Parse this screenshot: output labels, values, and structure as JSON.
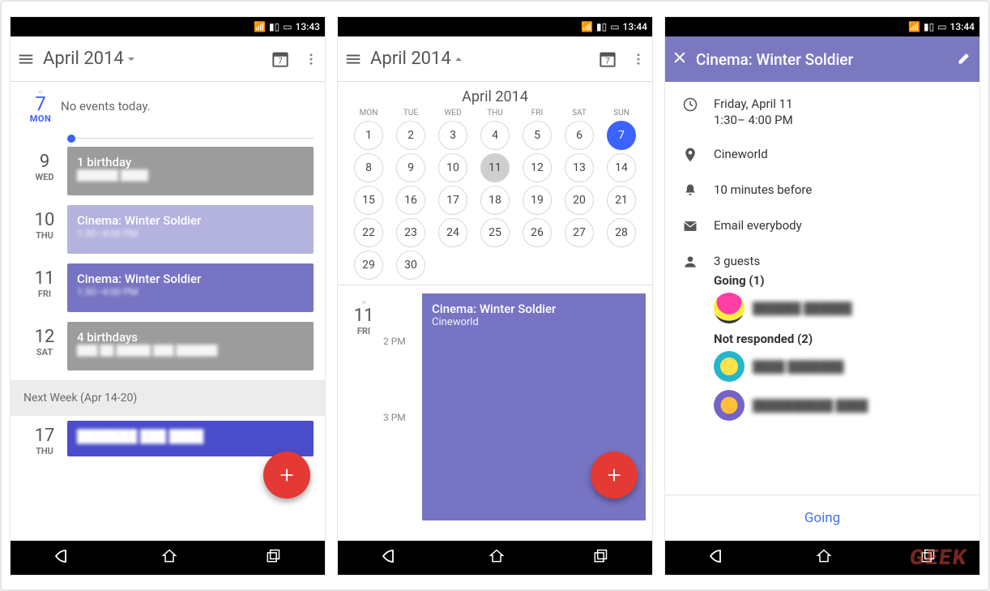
{
  "status": {
    "time1": "13:43",
    "time2": "13:44",
    "time3": "13:44"
  },
  "appbar": {
    "title": "April 2014",
    "cal_num": "7"
  },
  "agenda": {
    "today": {
      "num": "7",
      "dow": "MON"
    },
    "no_events": "No events today.",
    "rows": [
      {
        "num": "9",
        "dow": "WED",
        "kind": "gray",
        "t1": "1 birthday",
        "t2": "██████ ████"
      },
      {
        "num": "10",
        "dow": "THU",
        "kind": "lightpurple",
        "t1": "Cinema: Winter Soldier",
        "t2": "1:30–4:00 PM"
      },
      {
        "num": "11",
        "dow": "FRI",
        "kind": "purple",
        "t1": "Cinema: Winter Soldier",
        "t2": "1:30–4:00 PM"
      },
      {
        "num": "12",
        "dow": "SAT",
        "kind": "gray",
        "t1": "4 birthdays",
        "t2": "███ ██ █████ ███ ██████"
      }
    ],
    "next_week": "Next Week (Apr 14-20)",
    "partial": {
      "num": "17",
      "dow": "THU",
      "t1": "███████ ███ ████"
    }
  },
  "month": {
    "header": "April 2014",
    "weekdays": [
      "MON",
      "TUE",
      "WED",
      "THU",
      "FRI",
      "SAT",
      "SUN"
    ],
    "first_offset": 0,
    "days_in_month": 30,
    "today": 7,
    "selected": 11,
    "sel_date": {
      "num": "11",
      "dow": "FRI"
    },
    "hours": [
      "2 PM",
      "3 PM"
    ],
    "event": {
      "t1": "Cinema: Winter Soldier",
      "t2": "Cineworld"
    }
  },
  "detail": {
    "title": "Cinema: Winter Soldier",
    "date": "Friday, April 11",
    "time": "1:30– 4:00 PM",
    "location": "Cineworld",
    "reminder": "10 minutes before",
    "email": "Email everybody",
    "guests_count": "3 guests",
    "going_label": "Going (1)",
    "notresp_label": "Not responded (2)",
    "guest1": "██████ ██████",
    "guest2": "████ ███████",
    "guest3": "██████████ ████",
    "going_btn": "Going"
  },
  "watermark": "GEEK"
}
